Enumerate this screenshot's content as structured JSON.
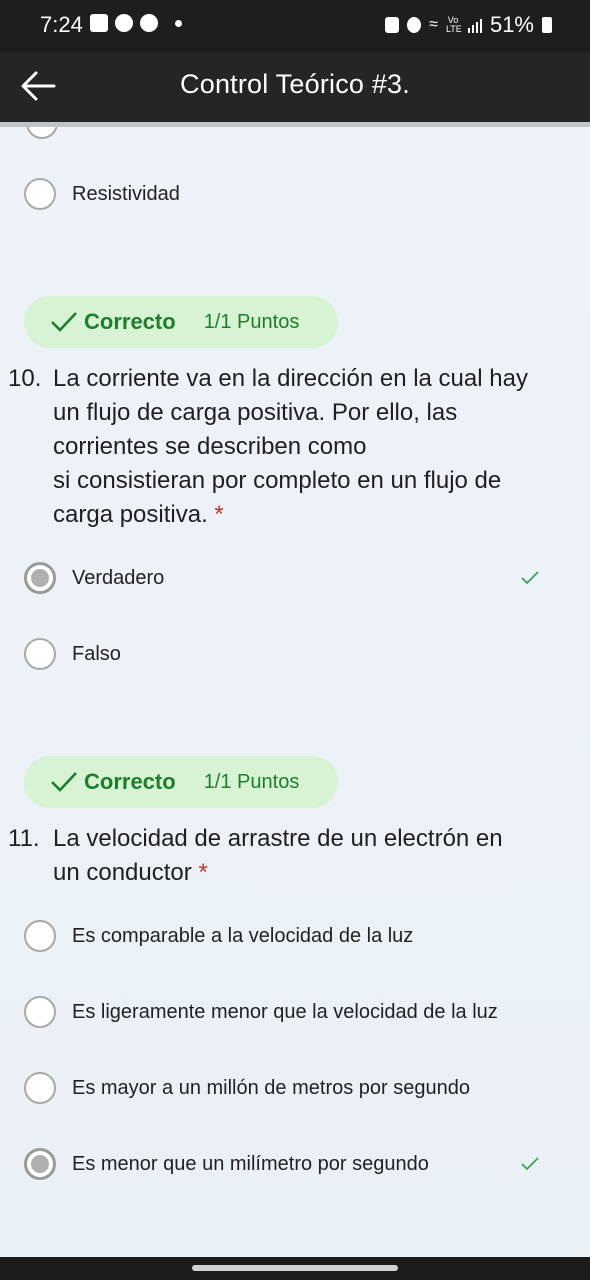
{
  "status_bar": {
    "time": "7:24",
    "battery": "51%",
    "left_icons": [
      "image-icon",
      "chat-icon",
      "facebook-icon",
      "dot-icon"
    ],
    "right_icons": [
      "battery-saver-icon",
      "alarm-icon",
      "wifi-icon",
      "volte-icon",
      "signal-icon",
      "battery-icon"
    ],
    "lte_label": "Vo LTE"
  },
  "app_bar": {
    "title": "Control Teórico #3.",
    "back_icon": "arrow-left-icon"
  },
  "prev_question": {
    "option": "Resistividad"
  },
  "questions": [
    {
      "badge": {
        "status": "Correcto",
        "points": "1/1 Puntos",
        "icon": "check-icon"
      },
      "number": "10.",
      "lines": [
        "La corriente va en la dirección en la cual hay",
        "un flujo de carga positiva. Por ello, las",
        "corrientes se describen como",
        "si consistieran por completo en un flujo de",
        "carga positiva."
      ],
      "required_marker": "*",
      "options": [
        {
          "label": "Verdadero",
          "selected": true,
          "correct": true
        },
        {
          "label": "Falso",
          "selected": false,
          "correct": false
        }
      ]
    },
    {
      "badge": {
        "status": "Correcto",
        "points": "1/1 Puntos",
        "icon": "check-icon"
      },
      "number": "11.",
      "lines": [
        "La velocidad de arrastre de un electrón en",
        "un conductor"
      ],
      "required_marker": "*",
      "options": [
        {
          "label": "Es comparable a la velocidad de la luz",
          "selected": false,
          "correct": false
        },
        {
          "label": "Es ligeramente menor que la velocidad de la luz",
          "selected": false,
          "correct": false
        },
        {
          "label": "Es mayor a un millón de metros por segundo",
          "selected": false,
          "correct": false
        },
        {
          "label": "Es menor que un milímetro por segundo",
          "selected": true,
          "correct": true
        }
      ]
    }
  ],
  "colors": {
    "badge_bg": "#d8f3d3",
    "correct_green": "#1b7f2b",
    "required_red": "#c0392b",
    "content_bg": "#eef3f9"
  }
}
